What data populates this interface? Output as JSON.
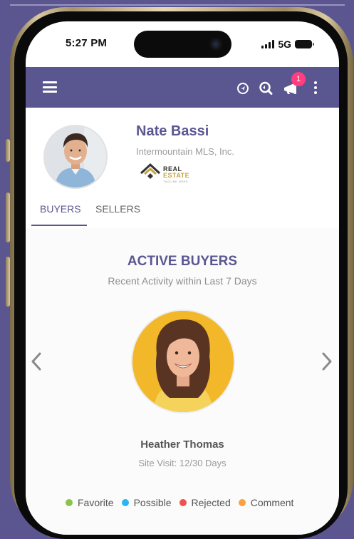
{
  "status_bar": {
    "time": "5:27 PM",
    "network": "5G"
  },
  "app_bar": {
    "notification_count": "1"
  },
  "agent": {
    "name": "Nate Bassi",
    "organization": "Intermountain MLS, Inc.",
    "logo": {
      "line1": "REAL",
      "line2": "ESTATE",
      "tagline": "TAGLINE HERE"
    }
  },
  "tabs": [
    {
      "label": "BUYERS",
      "active": true
    },
    {
      "label": "SELLERS",
      "active": false
    }
  ],
  "section": {
    "title": "ACTIVE BUYERS",
    "subtitle": "Recent Activity within Last 7 Days"
  },
  "buyer": {
    "name": "Heather Thomas",
    "visit": "Site Visit: 12/30 Days"
  },
  "legend": [
    {
      "label": "Favorite",
      "color": "#8bc34a"
    },
    {
      "label": "Possible",
      "color": "#29b6f6"
    },
    {
      "label": "Rejected",
      "color": "#ef5350"
    },
    {
      "label": "Comment",
      "color": "#ffa040"
    }
  ],
  "colors": {
    "brand": "#5a5790",
    "badge": "#ff3d7f",
    "background": "#5b5590"
  },
  "icons": [
    "menu-icon",
    "location-icon",
    "search-icon",
    "megaphone-icon",
    "more-vertical-icon",
    "chevron-left-icon",
    "chevron-right-icon"
  ]
}
